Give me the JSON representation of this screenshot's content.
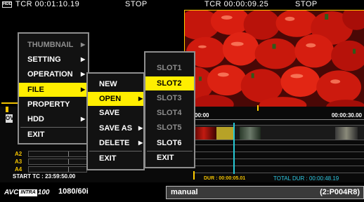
{
  "topbar": {
    "hdd_icon": "HDD",
    "left_timecode": "TCR 00:01:10.19",
    "left_status": "STOP",
    "right_timecode": "TCR 00:00:09.25",
    "right_status": "STOP"
  },
  "main_menu": {
    "items": [
      {
        "label": "THUMBNAIL",
        "arrow": "▶",
        "state": "disabled"
      },
      {
        "label": "SETTING",
        "arrow": "▶",
        "state": "normal"
      },
      {
        "label": "OPERATION",
        "arrow": "▶",
        "state": "normal"
      },
      {
        "label": "FILE",
        "arrow": "▶",
        "state": "selected"
      },
      {
        "label": "PROPERTY",
        "arrow": "",
        "state": "normal"
      },
      {
        "label": "HDD",
        "arrow": "▶",
        "state": "normal"
      },
      {
        "label": "EXIT",
        "arrow": "",
        "state": "normal"
      }
    ]
  },
  "file_menu": {
    "items": [
      {
        "label": "NEW",
        "arrow": "",
        "state": "normal"
      },
      {
        "label": "OPEN",
        "arrow": "▶",
        "state": "selected"
      },
      {
        "label": "SAVE",
        "arrow": "",
        "state": "normal"
      },
      {
        "label": "SAVE AS",
        "arrow": "▶",
        "state": "normal"
      },
      {
        "label": "DELETE",
        "arrow": "▶",
        "state": "normal"
      },
      {
        "label": "EXIT",
        "arrow": "",
        "state": "normal"
      }
    ]
  },
  "slot_menu": {
    "items": [
      {
        "label": "SLOT1",
        "state": "disabled"
      },
      {
        "label": "SLOT2",
        "state": "selected"
      },
      {
        "label": "SLOT3",
        "state": "disabled"
      },
      {
        "label": "SLOT4",
        "state": "disabled"
      },
      {
        "label": "SLOT5",
        "state": "disabled"
      },
      {
        "label": "SLOT6",
        "state": "normal"
      },
      {
        "label": "EXIT",
        "state": "normal"
      }
    ]
  },
  "timeline": {
    "ov_tag": "OV",
    "ruler_start": "00:00",
    "ruler_end": "00:00:30.00",
    "audio_tracks": [
      "A2",
      "A3",
      "A4"
    ],
    "start_tc": "START TC : 23:59:50.00",
    "duration": "DUR : 00:00:05.01",
    "total_duration": "TOTAL DUR : 00:00:48.19"
  },
  "bottombar": {
    "logo_avc": "AVC",
    "logo_intra": "INTRA",
    "logo_num": "100",
    "format": "1080/60i",
    "mode": "manual",
    "clip_id": "(2:P004R8)"
  },
  "colors": {
    "accent_yellow": "#ffee00",
    "menu_border": "#8e8e8e",
    "disabled_text": "#8d8d8d",
    "cyan": "#2ec8e2",
    "gold": "#f2c200"
  }
}
